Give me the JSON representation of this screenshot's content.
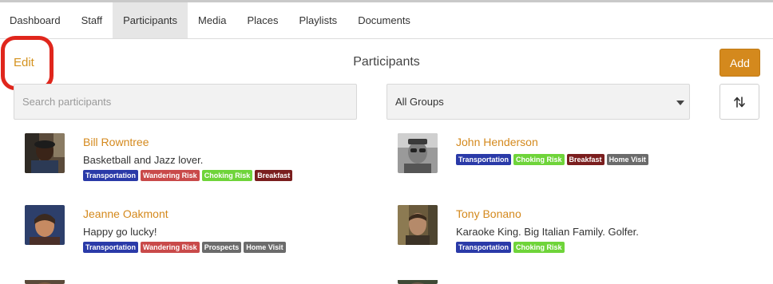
{
  "tabs": [
    {
      "label": "Dashboard"
    },
    {
      "label": "Staff"
    },
    {
      "label": "Participants",
      "active": true
    },
    {
      "label": "Media"
    },
    {
      "label": "Places"
    },
    {
      "label": "Playlists"
    },
    {
      "label": "Documents"
    }
  ],
  "header": {
    "edit_label": "Edit",
    "title": "Participants",
    "add_label": "Add"
  },
  "filters": {
    "search_placeholder": "Search participants",
    "group_selected": "All Groups"
  },
  "tag_colors": {
    "Transportation": "#2a3aa8",
    "Wandering Risk": "#c94a4a",
    "Choking Risk": "#6fd43a",
    "Breakfast": "#7a1e1e",
    "Prospects": "#6b6b6b",
    "Home Visit": "#6b6b6b"
  },
  "participants": [
    {
      "name": "Bill Rowntree",
      "description": "Basketball and Jazz lover.",
      "tags": [
        "Transportation",
        "Wandering Risk",
        "Choking Risk",
        "Breakfast"
      ]
    },
    {
      "name": "John Henderson",
      "description": "",
      "tags": [
        "Transportation",
        "Choking Risk",
        "Breakfast",
        "Home Visit"
      ]
    },
    {
      "name": "Jeanne Oakmont",
      "description": "Happy go lucky!",
      "tags": [
        "Transportation",
        "Wandering Risk",
        "Prospects",
        "Home Visit"
      ]
    },
    {
      "name": "Tony Bonano",
      "description": "Karaoke King. Big Italian Family. Golfer.",
      "tags": [
        "Transportation",
        "Choking Risk"
      ]
    }
  ]
}
